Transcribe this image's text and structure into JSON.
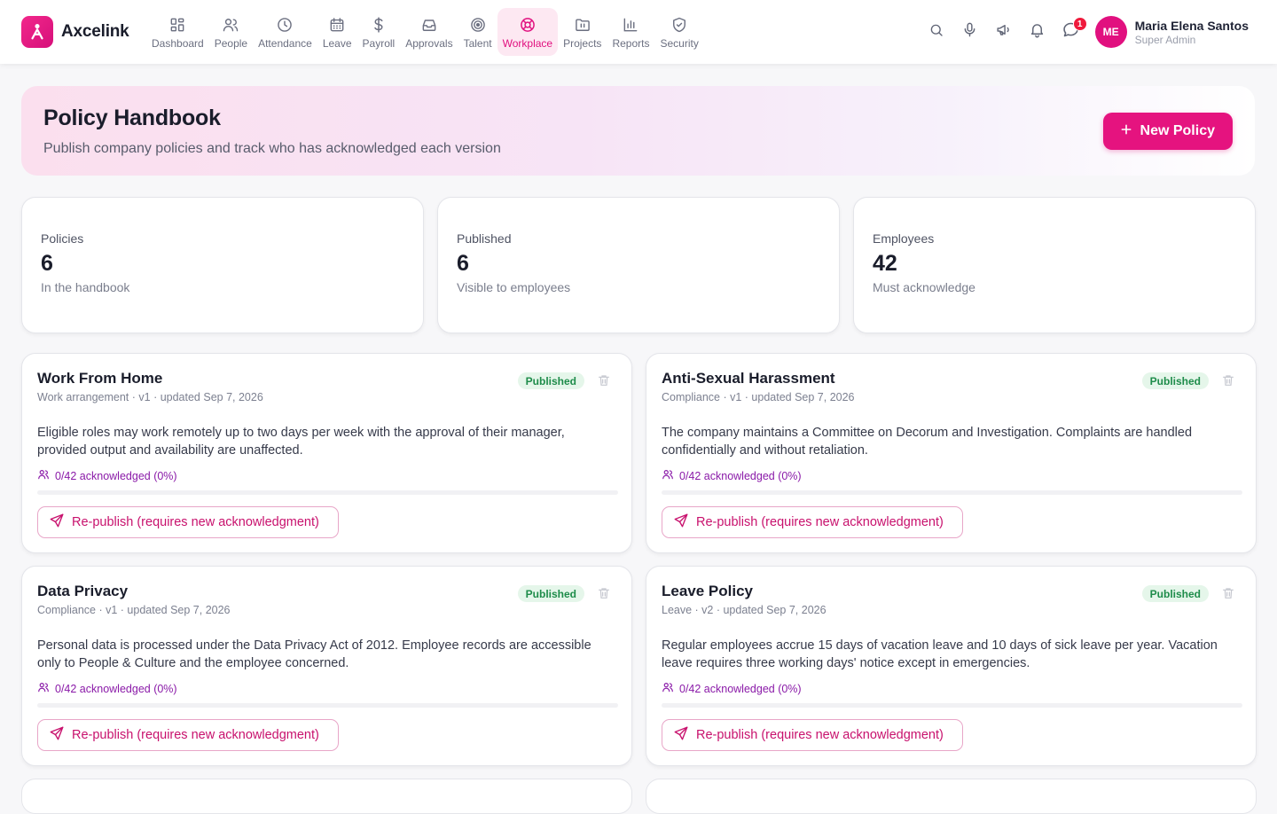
{
  "app": {
    "name": "Axcelink"
  },
  "nav": [
    {
      "label": "Dashboard",
      "icon": "dashboard-icon"
    },
    {
      "label": "People",
      "icon": "people-icon"
    },
    {
      "label": "Attendance",
      "icon": "clock-icon"
    },
    {
      "label": "Leave",
      "icon": "calendar-icon"
    },
    {
      "label": "Payroll",
      "icon": "dollar-icon"
    },
    {
      "label": "Approvals",
      "icon": "inbox-icon"
    },
    {
      "label": "Talent",
      "icon": "target-icon"
    },
    {
      "label": "Workplace",
      "icon": "lifebuoy-icon",
      "active": true
    },
    {
      "label": "Projects",
      "icon": "folder-icon"
    },
    {
      "label": "Reports",
      "icon": "bar-chart-icon"
    },
    {
      "label": "Security",
      "icon": "shield-icon"
    }
  ],
  "header": {
    "notification_count": "1",
    "user": {
      "initials": "ME",
      "name": "Maria Elena Santos",
      "role": "Super Admin"
    }
  },
  "hero": {
    "title": "Policy Handbook",
    "subtitle": "Publish company policies and track who has acknowledged each version",
    "new_button": "New Policy"
  },
  "stats": [
    {
      "label": "Policies",
      "value": "6",
      "sub": "In the handbook"
    },
    {
      "label": "Published",
      "value": "6",
      "sub": "Visible to employees"
    },
    {
      "label": "Employees",
      "value": "42",
      "sub": "Must acknowledge"
    }
  ],
  "policies": [
    {
      "title": "Work From Home",
      "meta": "Work arrangement · v1 · updated Sep 7, 2026",
      "status": "Published",
      "body": "Eligible roles may work remotely up to two days per week with the approval of their manager, provided output and availability are unaffected.",
      "ack": "0/42 acknowledged (0%)",
      "progress": 0,
      "action": "Re-publish (requires new acknowledgment)"
    },
    {
      "title": "Anti-Sexual Harassment",
      "meta": "Compliance · v1 · updated Sep 7, 2026",
      "status": "Published",
      "body": "The company maintains a Committee on Decorum and Investigation. Complaints are handled confidentially and without retaliation.",
      "ack": "0/42 acknowledged (0%)",
      "progress": 0,
      "action": "Re-publish (requires new acknowledgment)"
    },
    {
      "title": "Data Privacy",
      "meta": "Compliance · v1 · updated Sep 7, 2026",
      "status": "Published",
      "body": "Personal data is processed under the Data Privacy Act of 2012. Employee records are accessible only to People & Culture and the employee concerned.",
      "ack": "0/42 acknowledged (0%)",
      "progress": 0,
      "action": "Re-publish (requires new acknowledgment)"
    },
    {
      "title": "Leave Policy",
      "meta": "Leave · v2 · updated Sep 7, 2026",
      "status": "Published",
      "body": "Regular employees accrue 15 days of vacation leave and 10 days of sick leave per year. Vacation leave requires three working days' notice except in emergencies.",
      "ack": "0/42 acknowledged (0%)",
      "progress": 0,
      "action": "Re-publish (requires new acknowledgment)"
    }
  ],
  "colors": {
    "accent": "#e5137f",
    "published_bg": "#e5f6ea",
    "published_text": "#1e8c4a",
    "ack_text": "#8a1aa8"
  }
}
